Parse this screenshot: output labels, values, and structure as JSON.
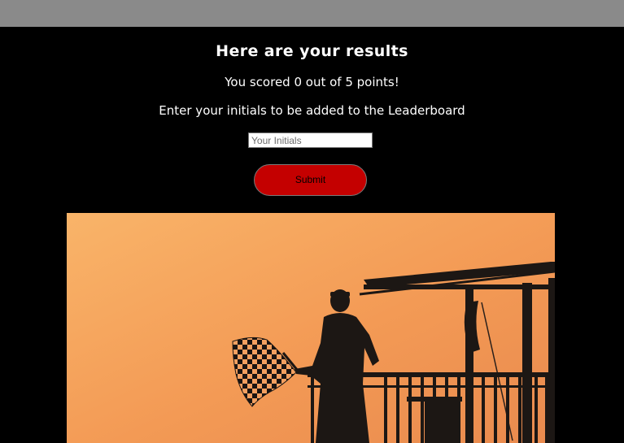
{
  "results": {
    "heading": "Here are your results",
    "score_text": "You scored 0 out of 5 points!",
    "leaderboard_prompt": "Enter your initials to be added to the Leaderboard"
  },
  "form": {
    "initials_placeholder": "Your Initials",
    "initials_value": "",
    "submit_label": "Submit"
  },
  "colors": {
    "background": "#000000",
    "top_bar": "#8a8a8a",
    "submit_button": "#c40000",
    "sky_light": "#f9b469",
    "sky_dark": "#e98a4e"
  },
  "image": {
    "subject": "silhouette of a race official waving a checkered flag from a tower at sunset"
  }
}
